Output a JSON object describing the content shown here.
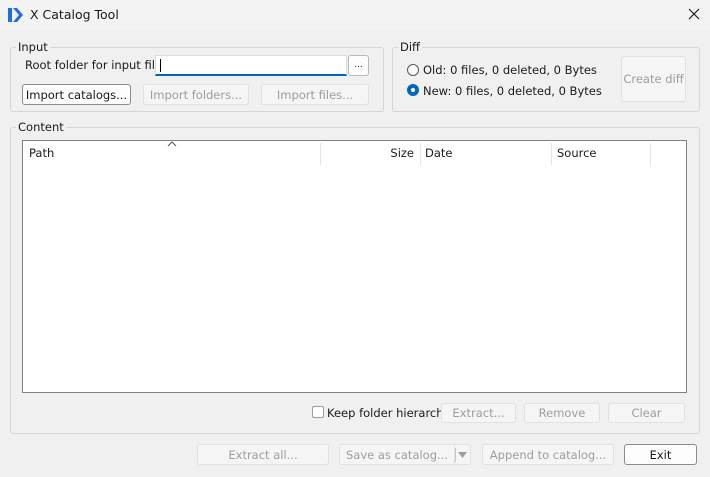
{
  "window": {
    "title": "X Catalog Tool",
    "app_icon": "x-catalog-logo-icon",
    "close_icon": "close-icon"
  },
  "input_group": {
    "title": "Input",
    "root_label": "Root folder for input files:",
    "root_value": "",
    "browse_label": "...",
    "import_catalogs": "Import catalogs...",
    "import_folders": "Import folders...",
    "import_files": "Import files..."
  },
  "diff_group": {
    "title": "Diff",
    "old_label": "Old: 0 files, 0 deleted, 0 Bytes",
    "new_label": "New: 0 files, 0 deleted, 0 Bytes",
    "selected": "new",
    "create_diff": "Create diff"
  },
  "content_group": {
    "title": "Content",
    "columns": [
      "Path",
      "Size",
      "Date",
      "Source"
    ],
    "sort_indicator": "^",
    "rows": [],
    "keep_hierarchy_label": "Keep folder hierarchy",
    "keep_hierarchy_checked": false,
    "extract": "Extract...",
    "remove": "Remove",
    "clear": "Clear"
  },
  "footer": {
    "extract_all": "Extract all...",
    "save_as_catalog": "Save as catalog...",
    "save_dropdown_icon": "dropdown-arrow-icon",
    "append_to_catalog": "Append to catalog...",
    "exit": "Exit"
  },
  "colors": {
    "accent": "#0067c0",
    "window_bg": "#f0f0f0",
    "disabled_text": "#9d9d9d"
  }
}
